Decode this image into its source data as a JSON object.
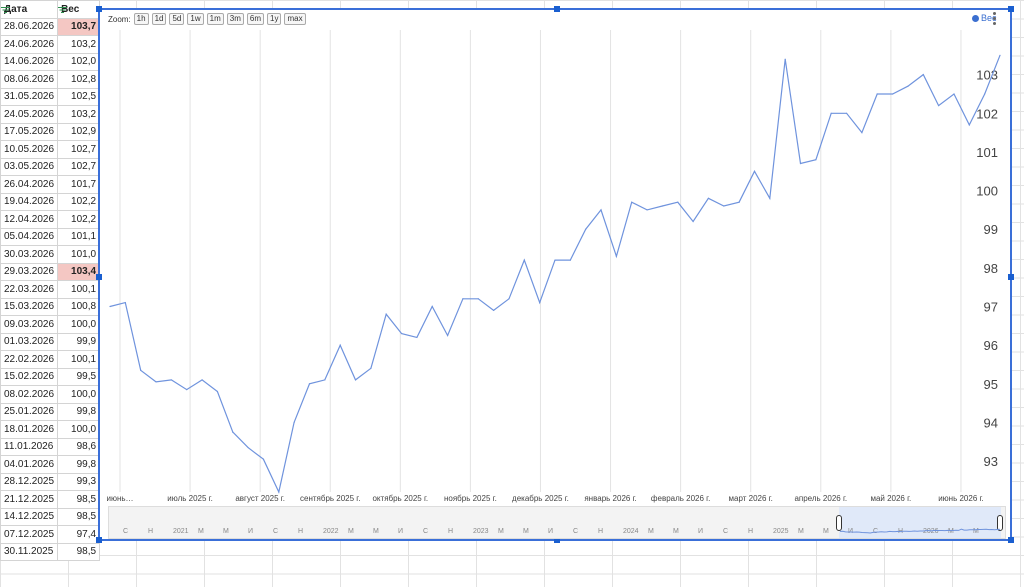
{
  "sheet": {
    "headers": {
      "date": "Дата",
      "weight": "Вес"
    },
    "rows": [
      {
        "date": "28.06.2026",
        "weight": "103,7",
        "hl": true
      },
      {
        "date": "24.06.2026",
        "weight": "103,2"
      },
      {
        "date": "14.06.2026",
        "weight": "102,0"
      },
      {
        "date": "08.06.2026",
        "weight": "102,8"
      },
      {
        "date": "31.05.2026",
        "weight": "102,5"
      },
      {
        "date": "24.05.2026",
        "weight": "103,2"
      },
      {
        "date": "17.05.2026",
        "weight": "102,9"
      },
      {
        "date": "10.05.2026",
        "weight": "102,7"
      },
      {
        "date": "03.05.2026",
        "weight": "102,7"
      },
      {
        "date": "26.04.2026",
        "weight": "101,7"
      },
      {
        "date": "19.04.2026",
        "weight": "102,2"
      },
      {
        "date": "12.04.2026",
        "weight": "102,2"
      },
      {
        "date": "05.04.2026",
        "weight": "101,1"
      },
      {
        "date": "30.03.2026",
        "weight": "101,0"
      },
      {
        "date": "29.03.2026",
        "weight": "103,4",
        "hl": true
      },
      {
        "date": "22.03.2026",
        "weight": "100,1"
      },
      {
        "date": "15.03.2026",
        "weight": "100,8"
      },
      {
        "date": "09.03.2026",
        "weight": "100,0"
      },
      {
        "date": "01.03.2026",
        "weight": "99,9"
      },
      {
        "date": "22.02.2026",
        "weight": "100,1"
      },
      {
        "date": "15.02.2026",
        "weight": "99,5"
      },
      {
        "date": "08.02.2026",
        "weight": "100,0"
      },
      {
        "date": "25.01.2026",
        "weight": "99,8"
      },
      {
        "date": "18.01.2026",
        "weight": "100,0"
      },
      {
        "date": "11.01.2026",
        "weight": "98,6"
      },
      {
        "date": "04.01.2026",
        "weight": "99,8"
      },
      {
        "date": "28.12.2025",
        "weight": "99,3"
      },
      {
        "date": "21.12.2025",
        "weight": "98,5"
      },
      {
        "date": "14.12.2025",
        "weight": "98,5"
      },
      {
        "date": "07.12.2025",
        "weight": "97,4"
      },
      {
        "date": "30.11.2025",
        "weight": "98,5"
      }
    ]
  },
  "chart_controls": {
    "zoom_label": "Zoom:",
    "zoom_buttons": [
      "1h",
      "1d",
      "5d",
      "1w",
      "1m",
      "3m",
      "6m",
      "1y",
      "max"
    ],
    "legend": "Вес"
  },
  "navigator_labels": [
    "С",
    "Н",
    "2021",
    "М",
    "М",
    "И",
    "С",
    "Н",
    "2022",
    "М",
    "М",
    "И",
    "С",
    "Н",
    "2023",
    "М",
    "М",
    "И",
    "С",
    "Н",
    "2024",
    "М",
    "М",
    "И",
    "С",
    "Н",
    "2025",
    "М",
    "М",
    "И",
    "С",
    "Н",
    "2026",
    "М",
    "М"
  ],
  "chart_data": {
    "type": "line",
    "title": "",
    "series": [
      {
        "name": "Вес",
        "color": "#6f93dd"
      }
    ],
    "y_ticks": [
      93,
      94,
      95,
      96,
      97,
      98,
      99,
      100,
      101,
      102,
      103
    ],
    "ylim": [
      92.2,
      104
    ],
    "x_tick_labels": [
      "июнь…",
      "июль 2025 г.",
      "август 2025 г.",
      "сентябрь 2025 г.",
      "октябрь 2025 г.",
      "ноябрь 2025 г.",
      "декабрь 2025 г.",
      "январь 2026 г.",
      "февраль 2026 г.",
      "март 2026 г.",
      "апрель 2026 г.",
      "май 2026 г.",
      "июнь 2026 г."
    ],
    "values": [
      97.0,
      97.1,
      95.35,
      95.05,
      95.1,
      94.85,
      95.1,
      94.8,
      93.75,
      93.35,
      93.05,
      92.2,
      94.0,
      95.0,
      95.1,
      96.0,
      95.1,
      95.4,
      96.8,
      96.3,
      96.2,
      97.0,
      96.25,
      97.2,
      97.2,
      96.9,
      97.2,
      98.2,
      97.1,
      98.2,
      98.2,
      99.0,
      99.5,
      98.3,
      99.7,
      99.5,
      99.6,
      99.7,
      99.2,
      99.8,
      99.6,
      99.7,
      100.5,
      99.8,
      103.4,
      100.7,
      100.8,
      102.0,
      102.0,
      101.5,
      102.5,
      102.5,
      102.7,
      103.0,
      102.2,
      102.5,
      101.7,
      102.5,
      103.5
    ]
  }
}
